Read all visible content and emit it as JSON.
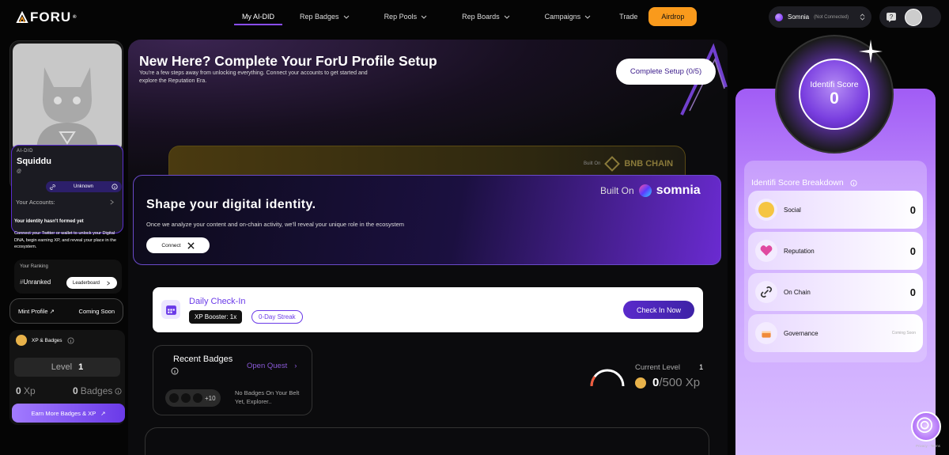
{
  "brand": {
    "name": "FORU"
  },
  "nav": {
    "items": [
      {
        "label": "My AI-DID",
        "active": true,
        "dropdown": false
      },
      {
        "label": "Rep Badges",
        "dropdown": true
      },
      {
        "label": "Rep Pools",
        "dropdown": true
      },
      {
        "label": "Rep Boards",
        "dropdown": true
      },
      {
        "label": "Campaigns",
        "dropdown": true
      },
      {
        "label": "Trade",
        "dropdown": false
      }
    ],
    "airdrop_label": "Airdrop",
    "chain": {
      "name": "Somnia",
      "status": "(Not Connected)"
    }
  },
  "sidebar": {
    "did_tag": "AI-DID",
    "username": "Squiddu",
    "handle": "@",
    "identity_status": "Unknown",
    "accounts_label": "Your Accounts:",
    "notice_title": "Your identity hasn't formed yet",
    "notice_body": "Connect your Twitter or wallet to unlock your Digital DNA, begin earning XP, and reveal your place in the ecosystem.",
    "ranking_label": "Your Ranking",
    "ranking_value": "Unranked",
    "leaderboard_label": "Leaderboard",
    "mint_label": "Mint Profile",
    "mint_status": "Coming Soon",
    "xp_section_label": "XP & Badges",
    "level_label": "Level",
    "level_value": "1",
    "xp_value": "0",
    "xp_unit": "Xp",
    "badges_value": "0",
    "badges_unit": "Badges",
    "earn_label": "Earn More Badges & XP"
  },
  "hero": {
    "title": "New Here? Complete Your ForU Profile Setup",
    "subtitle": "You're a few steps away from unlocking everything. Connect your accounts to get started and explore the Reputation Era.",
    "setup_button": "Complete Setup (0/5)",
    "bnb": {
      "built_on": "Built On",
      "chain": "BNB CHAIN"
    },
    "somnia": {
      "built_on": "Built On",
      "chain": "somnia",
      "title": "Shape your digital identity.",
      "body": "Once we analyze your content and on-chain activity, we'll reveal your unique role in the ecosystem",
      "connect_label": "Connect"
    }
  },
  "checkin": {
    "title": "Daily Check-In",
    "booster": "XP Booster: 1x",
    "streak": "0-Day Streak",
    "button": "Check In Now"
  },
  "badges": {
    "title": "Recent Badges",
    "open_quest": "Open Quest",
    "more_count": "+10",
    "empty_text": "No Badges On Your Belt Yet, Explorer.."
  },
  "level_progress": {
    "label": "Current Level",
    "level": "1",
    "xp_current": "0",
    "xp_target": "/500 Xp",
    "progress": 0
  },
  "score": {
    "title": "Identifi Score",
    "value": "0",
    "breakdown_title": "Identifi Score Breakdown",
    "rows": [
      {
        "label": "Social",
        "value": "0",
        "icon": "face-icon"
      },
      {
        "label": "Reputation",
        "value": "0",
        "icon": "heart-icon"
      },
      {
        "label": "On Chain",
        "value": "0",
        "icon": "link-icon"
      },
      {
        "label": "Governance",
        "value": "Coming Soon",
        "icon": "cake-icon"
      }
    ]
  },
  "recaptcha_text": "Privacy - Terms",
  "colors": {
    "accent": "#8a4dff",
    "airdrop": "#f99a1c",
    "score_panel": "#b57cff"
  }
}
